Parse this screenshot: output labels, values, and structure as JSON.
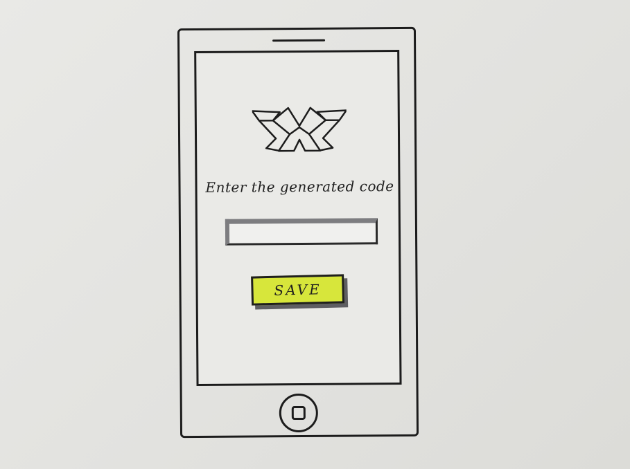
{
  "screen": {
    "logo_icon": "x-shaped-logo-icon",
    "prompt": "Enter the generated code",
    "code_input": {
      "value": "",
      "placeholder": ""
    },
    "save_button_label": "SAVE",
    "save_button_color": "#d7e63b"
  },
  "device": {
    "home_icon": "home-button-icon"
  }
}
